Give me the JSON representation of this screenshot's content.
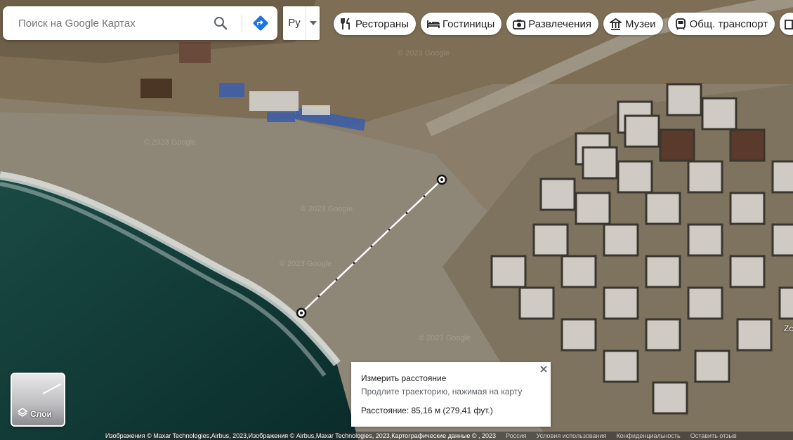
{
  "search": {
    "placeholder": "Поиск на Google Картах",
    "icon": "search-icon",
    "directions_icon": "directions-icon"
  },
  "language": {
    "code": "Ру"
  },
  "chips": [
    {
      "label": "Рестораны",
      "icon": "restaurant-icon"
    },
    {
      "label": "Гостиницы",
      "icon": "hotel-icon"
    },
    {
      "label": "Развлечения",
      "icon": "camera-icon"
    },
    {
      "label": "Музеи",
      "icon": "museum-icon"
    },
    {
      "label": "Общ. транспорт",
      "icon": "transit-icon"
    }
  ],
  "layers": {
    "label": "Слои",
    "icon": "layers-icon"
  },
  "measure": {
    "title": "Измерить расстояние",
    "subtitle": "Продлите траекторию, нажимая на карту",
    "distance": "Расстояние: 85,16 м (279,41 фут.)",
    "close_icon": "close-icon"
  },
  "watermark": "© 2023 Google",
  "edge_label": "Zc",
  "footer": {
    "imagery": "Изображения © Maxar Technologies,Airbus, 2023,Изображения © Airbus,Maxar Technologies, 2023,Картографические данные © , 2023",
    "country": "Россия",
    "terms": "Условия использования",
    "privacy": "Конфиденциальность",
    "feedback": "Оставить отзыв"
  },
  "colors": {
    "accent": "#1a73e8",
    "sea": "#0d3a36",
    "sand": "#8f8878"
  }
}
